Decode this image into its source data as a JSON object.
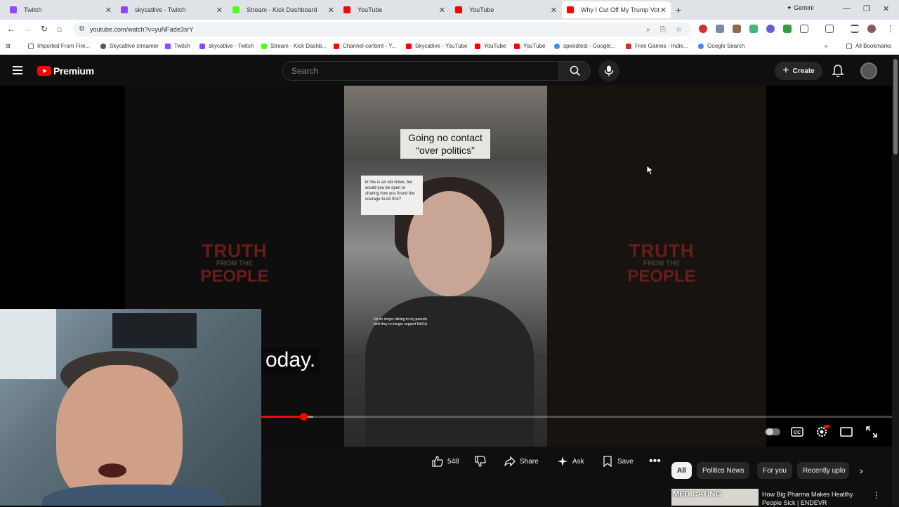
{
  "browser": {
    "tabs": [
      {
        "title": "Twitch",
        "icon": "twitch-icon"
      },
      {
        "title": "skycatlive - Twitch",
        "icon": "twitch-icon"
      },
      {
        "title": "Stream - Kick Dashboard",
        "icon": "kick-icon"
      },
      {
        "title": "YouTube",
        "icon": "youtube-icon"
      },
      {
        "title": "YouTube",
        "icon": "youtube-icon"
      },
      {
        "title": "Why I Cut Off My Trump Voting",
        "icon": "youtube-icon"
      }
    ],
    "gemini_label": "Gemini",
    "url": "youtube.com/watch?v=yuNFade3srY",
    "bookmarks": [
      "Imported From Fire...",
      "Skycatlive streamer",
      "Twitch",
      "skycatlive - Twitch",
      "Stream - Kick Dashb...",
      "Channel content - Y...",
      "Skycatlive - YouTube",
      "YouTube",
      "YouTube",
      "speedtest - Google...",
      "Free Games - Indie...",
      "Google Search"
    ],
    "all_bookmarks_label": "All Bookmarks",
    "colors": {
      "tab_bg": "#dfe3e8",
      "accent": "#ff0000"
    }
  },
  "youtube": {
    "logo_text": "Premium",
    "search_placeholder": "Search",
    "create_label": "Create"
  },
  "player": {
    "caption_line1": "Going no contact",
    "caption_line2": "“over politics”",
    "comment_text": "ik this is an old video, but would you be open to sharing how you found the courage to do this?",
    "inner_subtitle": "I'm no longer talking to my parents until they no longer support MAGA",
    "brand_line1": "TRUTH",
    "brand_line2": "FROM THE",
    "brand_line3": "PEOPLE",
    "subtitle": "oday.",
    "progress_fraction": 0.34
  },
  "actions": {
    "like_count": "548",
    "share_label": "Share",
    "ask_label": "Ask",
    "save_label": "Save"
  },
  "chips": [
    "All",
    "Politics News",
    "For you",
    "Recently uplo"
  ],
  "recommendation": {
    "thumb_text": "MEDICATING",
    "title": "How Big Pharma Makes Healthy People Sick | ENDEVR"
  }
}
